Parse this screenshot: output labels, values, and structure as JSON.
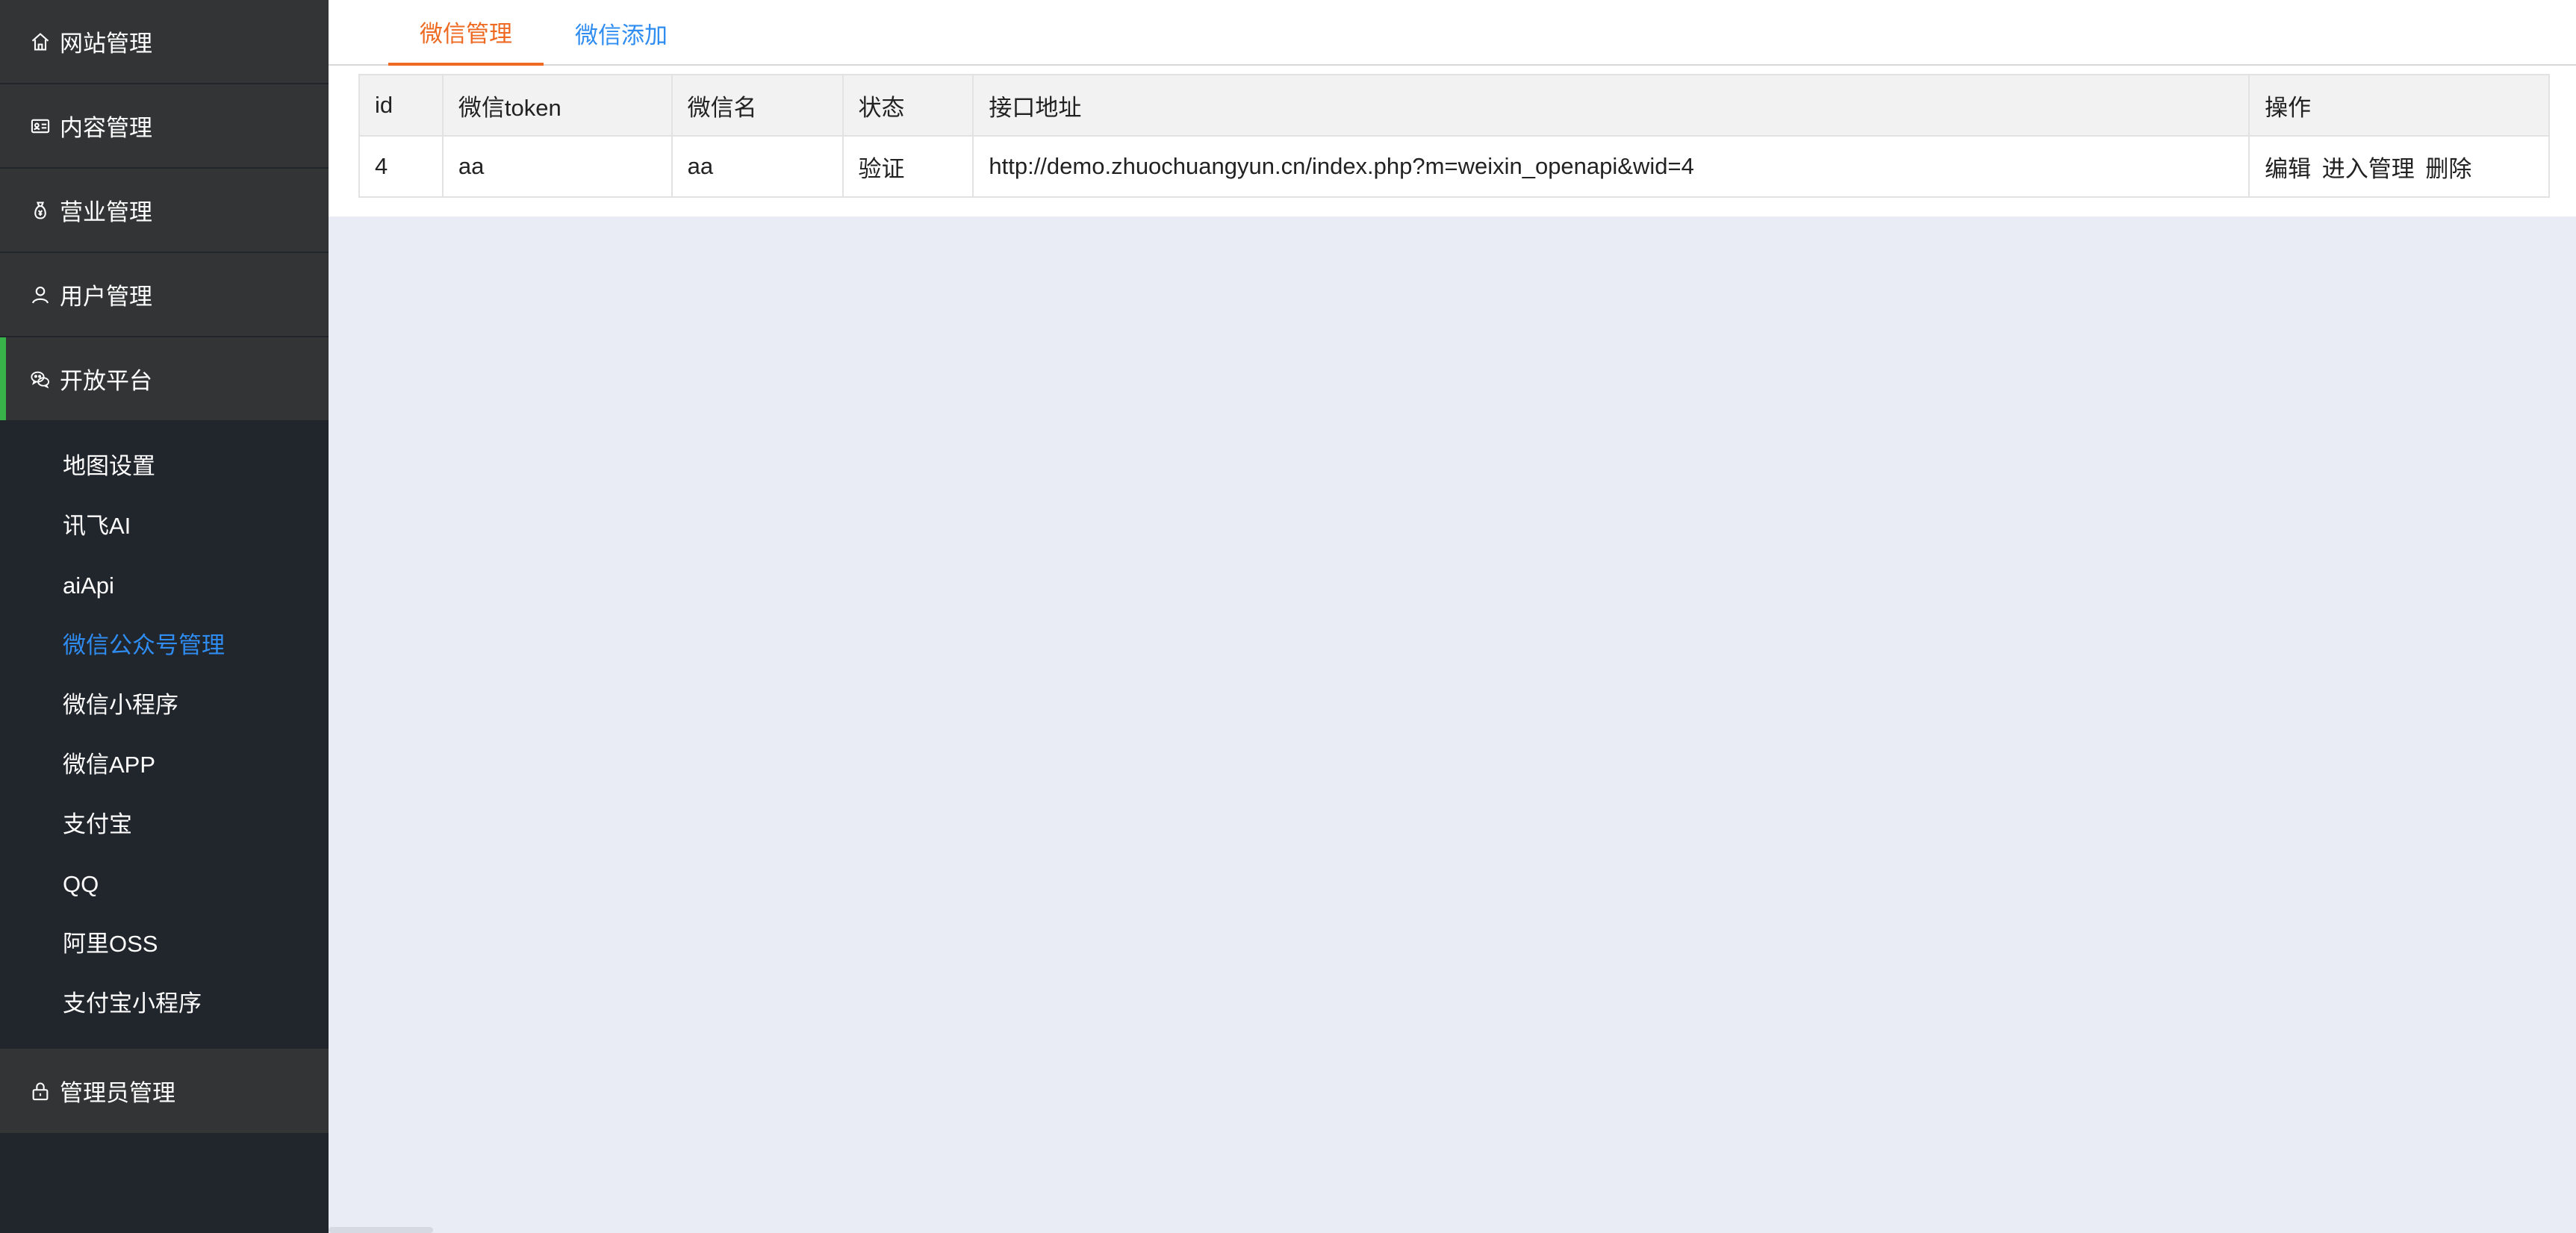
{
  "sidebar": {
    "groups": [
      {
        "label": "网站管理",
        "icon": "home-icon"
      },
      {
        "label": "内容管理",
        "icon": "id-card-icon"
      },
      {
        "label": "营业管理",
        "icon": "money-bag-icon"
      },
      {
        "label": "用户管理",
        "icon": "user-icon"
      },
      {
        "label": "开放平台",
        "icon": "wechat-icon"
      },
      {
        "label": "管理员管理",
        "icon": "lock-icon"
      }
    ],
    "submenu": [
      {
        "label": "地图设置"
      },
      {
        "label": "讯飞AI"
      },
      {
        "label": "aiApi"
      },
      {
        "label": "微信公众号管理"
      },
      {
        "label": "微信小程序"
      },
      {
        "label": "微信APP"
      },
      {
        "label": "支付宝"
      },
      {
        "label": "QQ"
      },
      {
        "label": "阿里OSS"
      },
      {
        "label": "支付宝小程序"
      }
    ],
    "accent_color": "#37b34a",
    "active_sub_color": "#2f8cf0"
  },
  "tabs": [
    {
      "label": "微信管理"
    },
    {
      "label": "微信添加"
    }
  ],
  "table": {
    "headers": [
      "id",
      "微信token",
      "微信名",
      "状态",
      "接口地址",
      "操作"
    ],
    "rows": [
      {
        "id": "4",
        "token": "aa",
        "name": "aa",
        "status": "验证",
        "url": "http://demo.zhuochuangyun.cn/index.php?m=weixin_openapi&wid=4",
        "actions": [
          "编辑",
          "进入管理",
          "删除"
        ]
      }
    ]
  },
  "colors": {
    "tab_active": "#ee6a22",
    "tab_link": "#2f8cf0",
    "sidebar_bg": "#21252c",
    "group_bg": "#333435"
  }
}
